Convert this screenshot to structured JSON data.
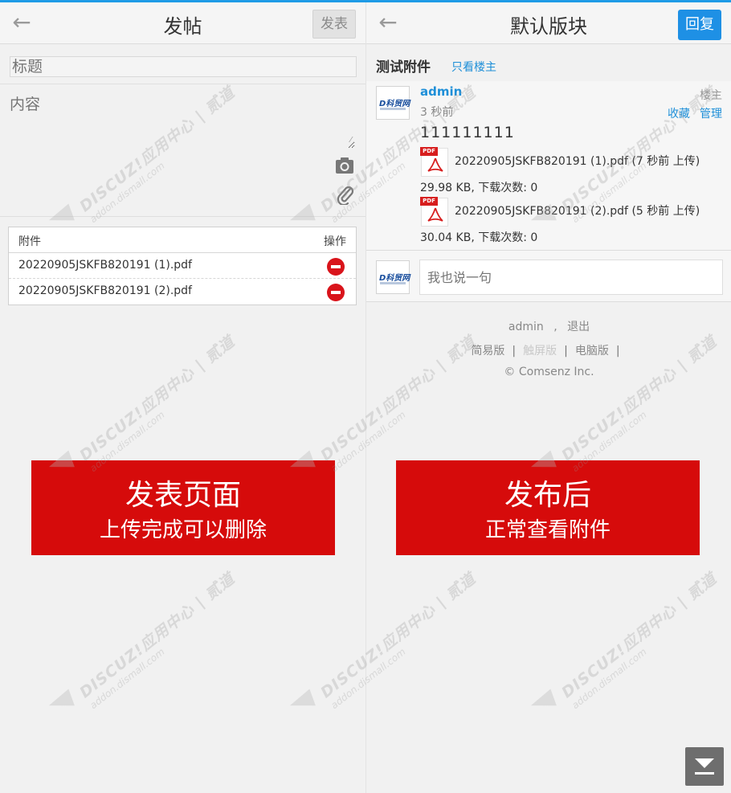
{
  "left": {
    "header_title": "发帖",
    "publish_label": "发表",
    "title_placeholder": "标题",
    "content_placeholder": "内容",
    "attachments": {
      "col_name": "附件",
      "col_action": "操作",
      "rows": [
        {
          "name": "20220905JSKFB820191 (1).pdf"
        },
        {
          "name": "20220905JSKFB820191 (2).pdf"
        }
      ]
    },
    "banner": {
      "line1": "发表页面",
      "line2": "上传完成可以删除"
    }
  },
  "right": {
    "header_title": "默认版块",
    "reply_label": "回复",
    "thread_title": "测试附件",
    "only_op": "只看楼主",
    "post": {
      "username": "admin",
      "time": "3 秒前",
      "op_label": "楼主",
      "fav": "收藏",
      "manage": "管理",
      "body": "111111111",
      "files": [
        {
          "name": "20220905JSKFB820191 (1).pdf (7 秒前 上传)",
          "meta": "29.98 KB, 下载次数: 0"
        },
        {
          "name": "20220905JSKFB820191 (2).pdf (5 秒前 上传)",
          "meta": "30.04 KB, 下载次数: 0"
        }
      ]
    },
    "reply_placeholder": "我也说一句",
    "footer": {
      "user": "admin",
      "comma": ",",
      "logout": "退出",
      "simple": "简易版",
      "touch": "触屏版",
      "pc": "电脑版",
      "copyright": "© Comsenz Inc."
    },
    "banner": {
      "line1": "发布后",
      "line2": "正常查看附件"
    }
  },
  "watermark": {
    "main": "DISCUZ!应用中心 | 贰道",
    "sub": "addon.dismall.com"
  },
  "avatar_logo": "D科贸网",
  "pdf_tag": "PDF",
  "colors": {
    "accent": "#1e90e5",
    "banner": "#d60b0b",
    "delete": "#d9141b"
  }
}
